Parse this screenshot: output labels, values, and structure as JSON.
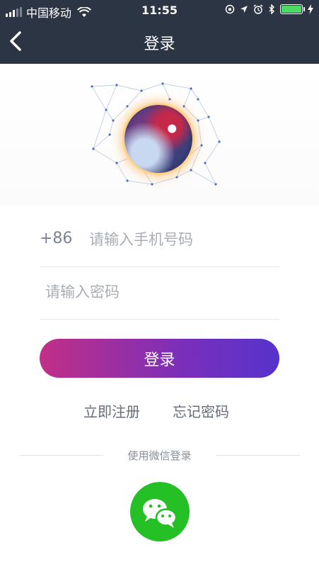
{
  "status_bar": {
    "carrier": "中国移动",
    "time": "11:55"
  },
  "nav": {
    "title": "登录"
  },
  "form": {
    "country_code": "+86",
    "phone_placeholder": "请输入手机号码",
    "password_placeholder": "请输入密码",
    "login_label": "登录"
  },
  "links": {
    "register": "立即注册",
    "forgot_password": "忘记密码"
  },
  "social": {
    "divider_text": "使用微信登录",
    "wechat_icon": "wechat-icon"
  },
  "colors": {
    "nav_bg": "#2c3544",
    "button_gradient_start": "#c12f87",
    "button_gradient_end": "#5533cc",
    "wechat_green": "#25c025",
    "battery_green": "#4cd964"
  }
}
